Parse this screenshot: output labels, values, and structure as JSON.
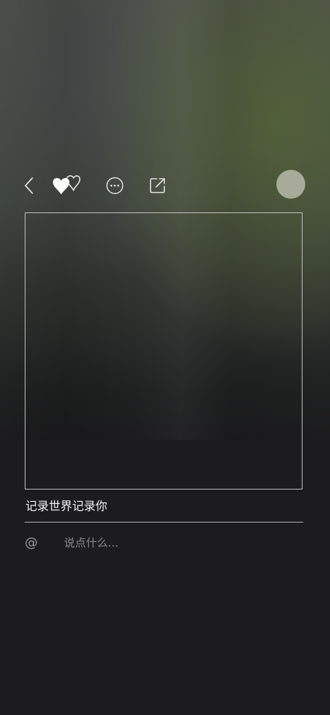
{
  "post": {
    "caption": "记录世界记录你"
  },
  "comment": {
    "mention_symbol": "@",
    "placeholder": "说点什么..."
  },
  "icons": {
    "back": "chevron-left-icon",
    "likes": "double-heart-icon",
    "more": "ellipsis-circle-icon",
    "share": "share-icon"
  },
  "colors": {
    "background": "#1c1c1e",
    "frame_border": "#c8c8c8",
    "avatar": "#a8ab9a"
  }
}
